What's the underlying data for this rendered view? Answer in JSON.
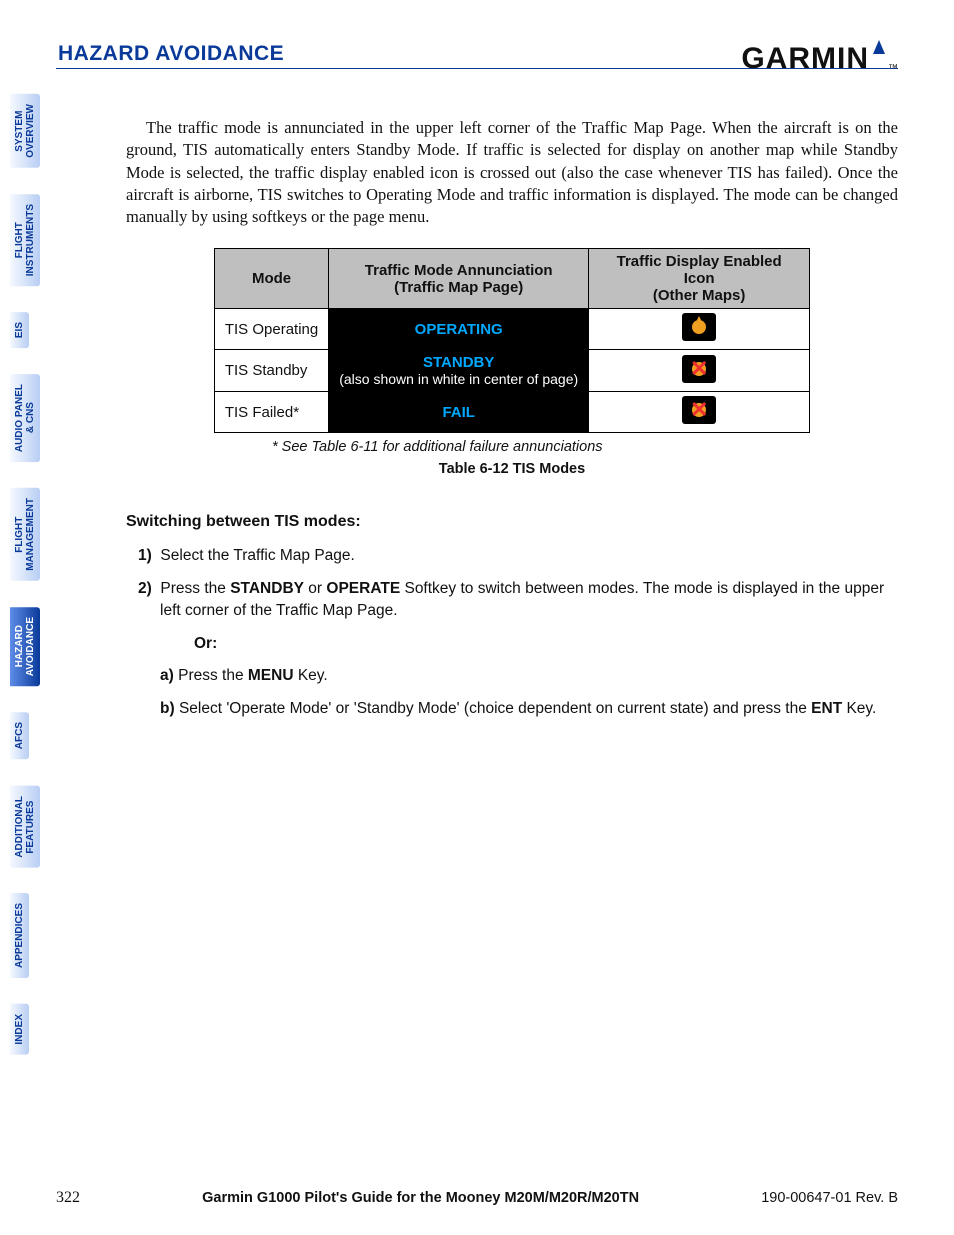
{
  "header": {
    "section_title": "HAZARD AVOIDANCE",
    "logo_text": "GARMIN",
    "logo_tm": "™"
  },
  "tabs": [
    {
      "label": "SYSTEM\nOVERVIEW",
      "active": false
    },
    {
      "label": "FLIGHT\nINSTRUMENTS",
      "active": false
    },
    {
      "label": "EIS",
      "active": false
    },
    {
      "label": "AUDIO PANEL\n& CNS",
      "active": false
    },
    {
      "label": "FLIGHT\nMANAGEMENT",
      "active": false
    },
    {
      "label": "HAZARD\nAVOIDANCE",
      "active": true
    },
    {
      "label": "AFCS",
      "active": false
    },
    {
      "label": "ADDITIONAL\nFEATURES",
      "active": false
    },
    {
      "label": "APPENDICES",
      "active": false
    },
    {
      "label": "INDEX",
      "active": false
    }
  ],
  "paragraph": "The traffic mode is annunciated in the upper left corner of the Traffic Map Page.  When the aircraft is on the ground, TIS automatically enters Standby Mode. If traffic is selected for display on another map while Standby Mode is selected, the traffic display enabled icon is crossed out (also the case whenever TIS has failed).  Once the aircraft is airborne, TIS switches to Operating Mode and traffic information is displayed.  The mode can be changed manually by using softkeys or the page menu.",
  "table": {
    "headers": {
      "mode": "Mode",
      "ann_l1": "Traffic Mode Annunciation",
      "ann_l2": "(Traffic Map Page)",
      "icon_l1": "Traffic Display Enabled Icon",
      "icon_l2": "(Other Maps)"
    },
    "rows": [
      {
        "mode": "TIS Operating",
        "ann": "OPERATING",
        "note": "",
        "icon": "op"
      },
      {
        "mode": "TIS Standby",
        "ann": "STANDBY",
        "note": "(also shown in white in center of page)",
        "icon": "x"
      },
      {
        "mode": "TIS Failed*",
        "ann": "FAIL",
        "note": "",
        "icon": "x"
      }
    ],
    "footnote": "* See Table 6-11 for additional failure annunciations",
    "caption": "Table 6-12  TIS Modes"
  },
  "steps": {
    "heading": "Switching between TIS modes:",
    "s1_n": "1)",
    "s1": "Select the Traffic Map Page.",
    "s2_n": "2)",
    "s2_p1": "Press the ",
    "s2_b1": "STANDBY",
    "s2_p2": " or ",
    "s2_b2": "OPERATE",
    "s2_p3": " Softkey to switch between modes.  The mode is displayed in the upper left corner of the Traffic Map Page.",
    "or": "Or:",
    "a_n": "a)",
    "a_p1": " Press the ",
    "a_b1": "MENU",
    "a_p2": " Key.",
    "b_n": "b)",
    "b_p1": " Select 'Operate Mode' or 'Standby Mode' (choice dependent on current state) and press the ",
    "b_b1": "ENT",
    "b_p2": " Key."
  },
  "footer": {
    "page": "322",
    "title": "Garmin G1000 Pilot's Guide for the Mooney M20M/M20R/M20TN",
    "rev": "190-00647-01  Rev. B"
  }
}
